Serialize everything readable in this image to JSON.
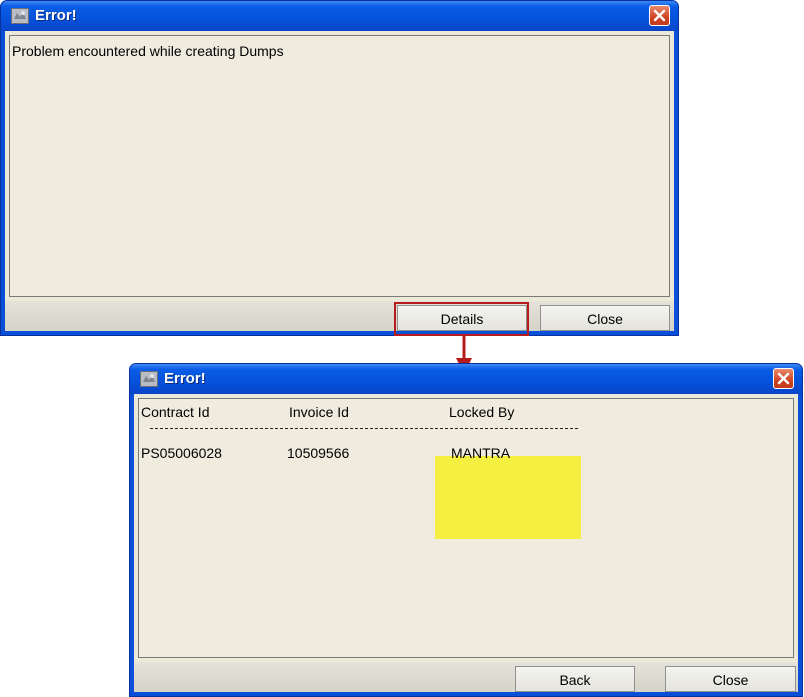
{
  "dialog1": {
    "title": "Error!",
    "message": "Problem encountered while creating Dumps",
    "buttons": {
      "details": "Details",
      "close": "Close"
    }
  },
  "dialog2": {
    "title": "Error!",
    "table": {
      "headers": [
        "Contract Id",
        "Invoice Id",
        "Locked By"
      ],
      "row": [
        "PS05006028",
        "10509566",
        "MANTRA"
      ]
    },
    "buttons": {
      "back": "Back",
      "close": "Close"
    }
  },
  "colors": {
    "title_bar": "#0a5ce6",
    "dialog_bg": "#ece9d8",
    "annotation_red": "#b71c1c",
    "highlight_yellow": "#f5f040"
  },
  "icons": {
    "app_icon": "java-app-icon",
    "close_icon": "close-x-icon",
    "arrow": "arrow-down-icon"
  }
}
